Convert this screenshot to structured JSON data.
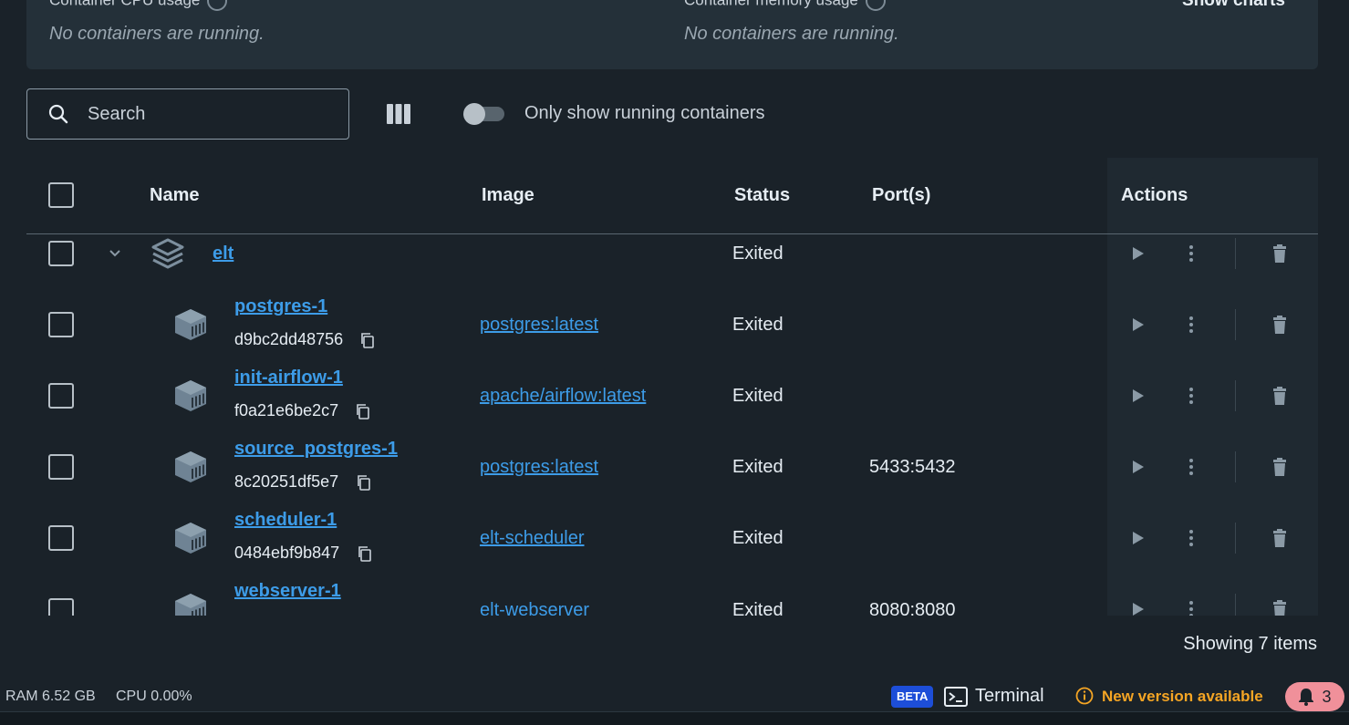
{
  "stats": {
    "cpu_label": "Container CPU usage",
    "cpu_empty": "No containers are running.",
    "memory_label": "Container memory usage",
    "memory_empty": "No containers are running.",
    "show_charts": "Show charts"
  },
  "toolbar": {
    "search_placeholder": "Search",
    "toggle_label": "Only show running containers",
    "toggle_on": false
  },
  "table": {
    "headers": {
      "name": "Name",
      "image": "Image",
      "status": "Status",
      "ports": "Port(s)",
      "actions": "Actions"
    },
    "group": {
      "name": "elt",
      "status": "Exited"
    },
    "rows": [
      {
        "name": "postgres-1",
        "id": "d9bc2dd48756",
        "image": "postgres:latest",
        "status": "Exited",
        "ports": ""
      },
      {
        "name": "init-airflow-1",
        "id": "f0a21e6be2c7",
        "image": "apache/airflow:latest",
        "status": "Exited",
        "ports": ""
      },
      {
        "name": "source_postgres-1",
        "id": "8c20251df5e7",
        "image": "postgres:latest",
        "status": "Exited",
        "ports": "5433:5432"
      },
      {
        "name": "scheduler-1",
        "id": "0484ebf9b847",
        "image": "elt-scheduler",
        "status": "Exited",
        "ports": ""
      },
      {
        "name": "webserver-1",
        "id": "",
        "image": "elt-webserver",
        "status": "Exited",
        "ports": "8080:8080"
      }
    ],
    "showing": "Showing 7 items"
  },
  "footer": {
    "ram": "RAM 6.52 GB",
    "cpu": "CPU 0.00%",
    "beta": "BETA",
    "terminal": "Terminal",
    "new_version": "New version available",
    "notifications": "3"
  },
  "colors": {
    "background": "#1a2229",
    "panel": "#243039",
    "link": "#3d9ce8",
    "warning": "#f5a524",
    "notification": "#f0909a",
    "beta": "#1d4ed8"
  }
}
